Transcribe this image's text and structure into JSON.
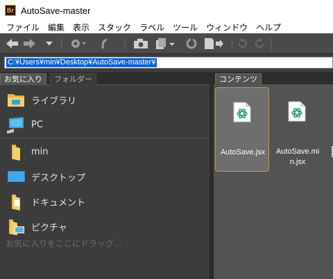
{
  "window": {
    "title": "AutoSave-master",
    "logo_text": "Br"
  },
  "menu": [
    "ファイル",
    "編集",
    "表示",
    "スタック",
    "ラベル",
    "ツール",
    "ウィンドウ",
    "ヘルプ"
  ],
  "path": {
    "value": "C:¥Users¥min¥Desktop¥AutoSave-master¥"
  },
  "left_panel": {
    "tabs": [
      {
        "label": "お気に入り",
        "active": true
      },
      {
        "label": "フォルダー",
        "active": false
      }
    ],
    "favorites": [
      {
        "label": "ライブラリ",
        "icon": "library-folder-icon"
      },
      {
        "label": "PC",
        "icon": "computer-icon"
      },
      {
        "label": "min",
        "icon": "folder-icon"
      },
      {
        "label": "デスクトップ",
        "icon": "desktop-icon"
      },
      {
        "label": "ドキュメント",
        "icon": "documents-folder-icon"
      },
      {
        "label": "ピクチャ",
        "icon": "pictures-folder-icon"
      }
    ],
    "drop_hint": "お気に入りをここにドラッグ..."
  },
  "content_panel": {
    "tab_label": "コンテンツ",
    "files": [
      {
        "name": "AutoSave.jsx",
        "selected": true,
        "icon": "jsx-script-icon"
      },
      {
        "name_line1": "AutoSave.mi",
        "name_line2": "n.jsx",
        "selected": false,
        "icon": "jsx-script-icon"
      }
    ]
  },
  "colors": {
    "toolbar": "#4a4a4a",
    "panel": "#3c3c3c",
    "content": "#535353",
    "selection_border": "#c89a30",
    "path_highlight": "#0a64d0"
  }
}
